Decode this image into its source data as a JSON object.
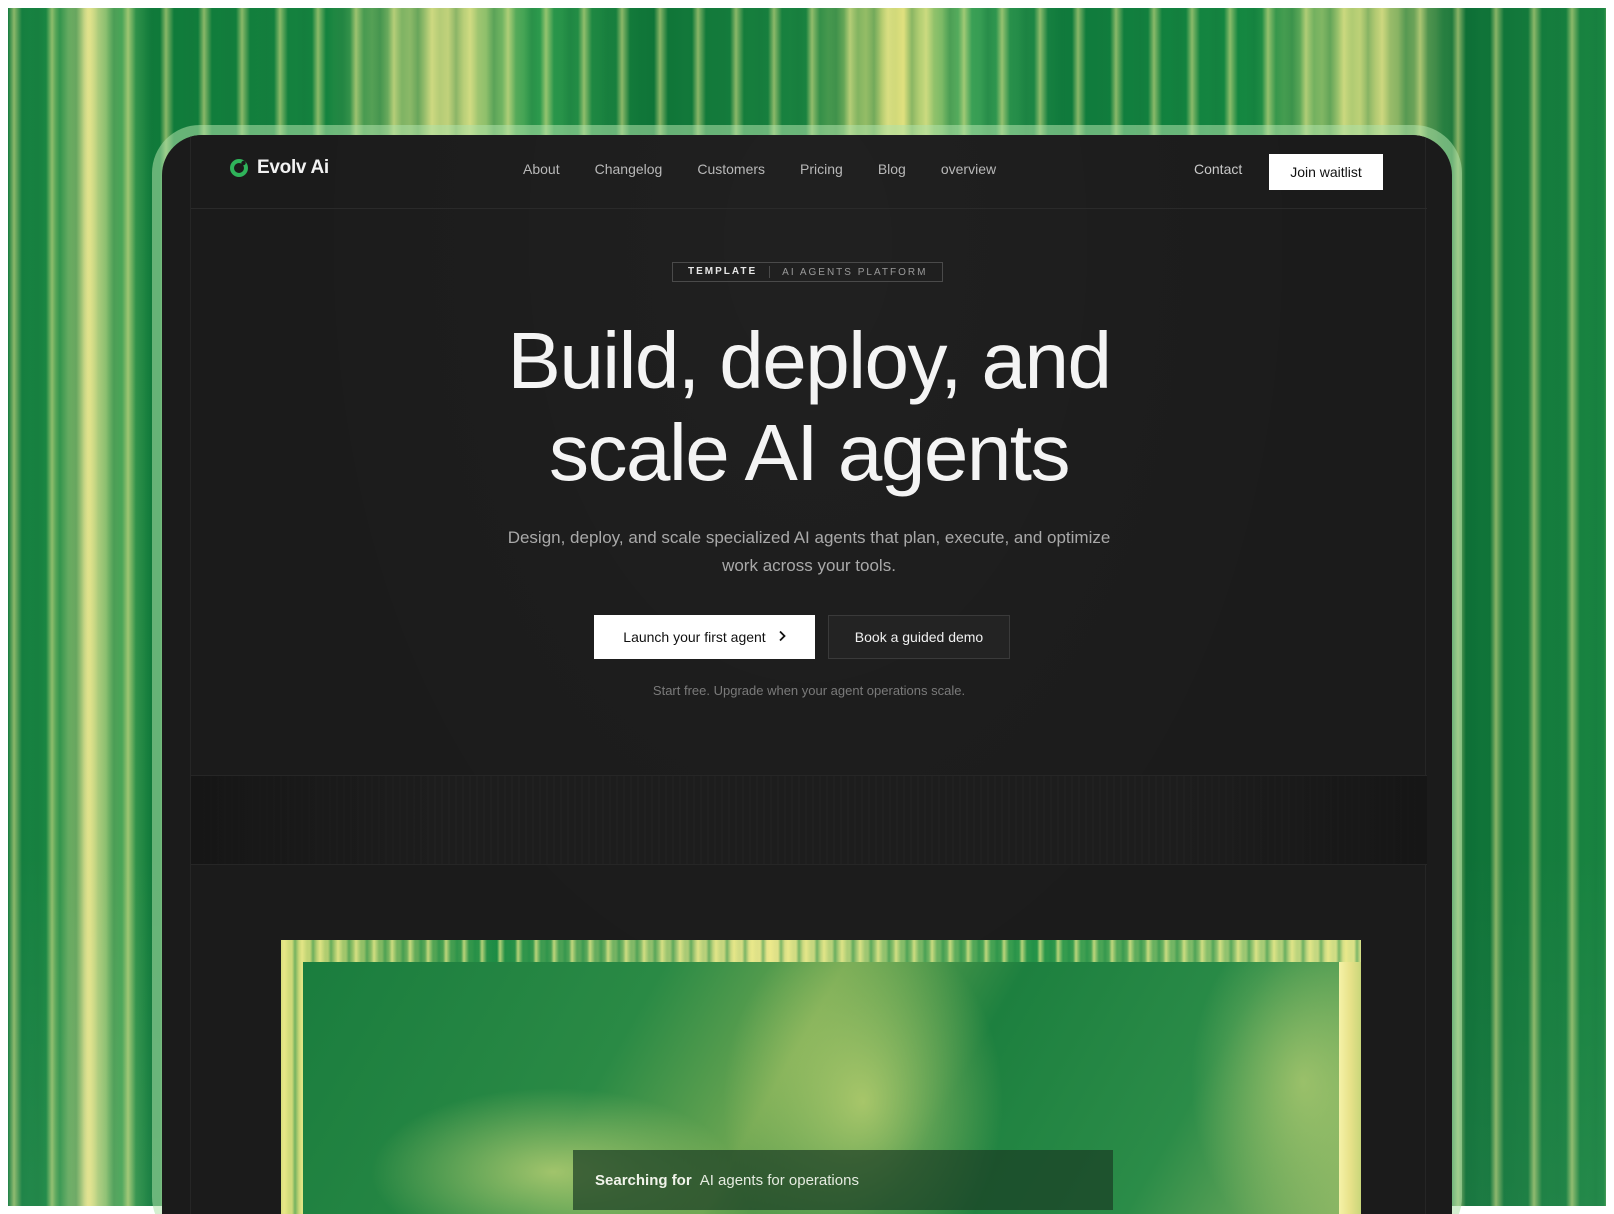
{
  "brand": {
    "name": "Evolv Ai",
    "accent": "#2fb35a"
  },
  "nav": {
    "links": [
      "About",
      "Changelog",
      "Customers",
      "Pricing",
      "Blog",
      "overview"
    ],
    "contact": "Contact",
    "cta": "Join waitlist"
  },
  "hero": {
    "badge_left": "TEMPLATE",
    "badge_right": "AI AGENTS PLATFORM",
    "title_line1": "Build, deploy, and",
    "title_line2": "scale AI agents",
    "subtitle_line1": "Design, deploy, and scale specialized AI agents that plan, execute, and optimize",
    "subtitle_line2": "work across your tools.",
    "primary_button": "Launch your first agent",
    "secondary_button": "Book a guided demo",
    "note": "Start free. Upgrade when your agent operations scale."
  },
  "showcase": {
    "search_label": "Searching for",
    "search_query": "AI agents for operations"
  },
  "icons": {
    "logo": "ring-logo-icon",
    "primary_button": "chevron-right-icon"
  }
}
